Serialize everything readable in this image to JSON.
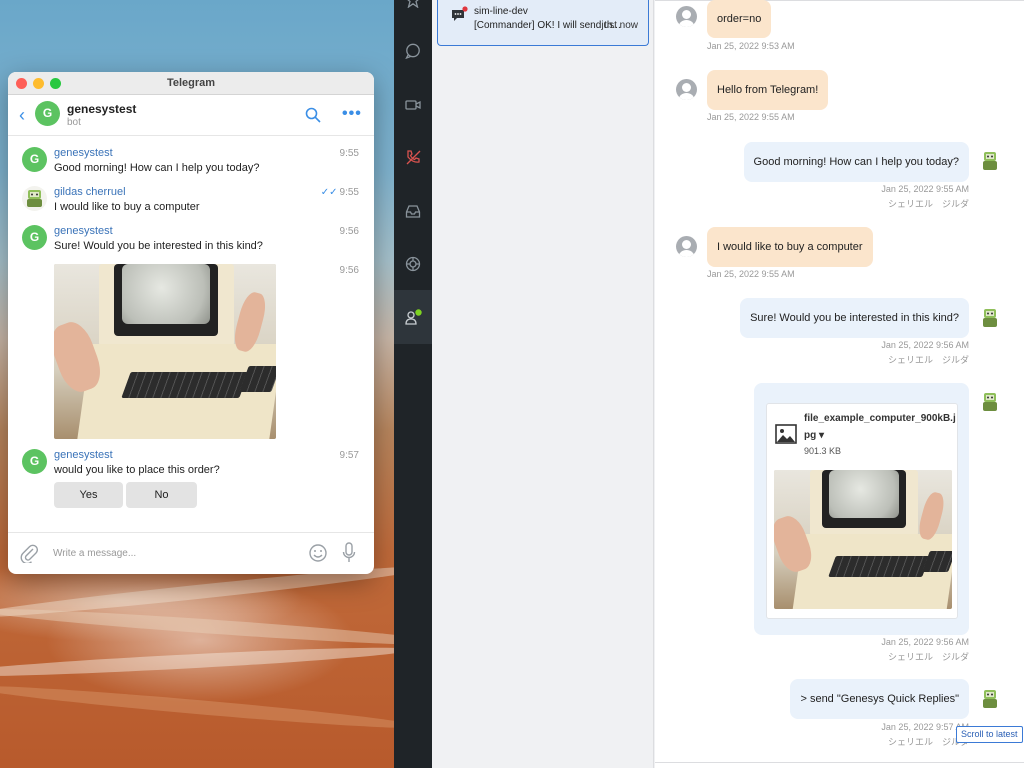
{
  "telegram": {
    "window_title": "Telegram",
    "chat_name": "genesystest",
    "chat_subtitle": "bot",
    "avatar_letter": "G",
    "messages": [
      {
        "sender": "genesystest",
        "text": "Good morning! How can I help you today?",
        "time": "9:55"
      },
      {
        "sender": "gildas cherruel",
        "text": "I would like to buy a computer",
        "time": "9:55"
      },
      {
        "sender": "genesystest",
        "text": "Sure! Would you be interested in this kind?",
        "time": "9:56"
      },
      {
        "sender": "",
        "text": "",
        "time": "9:56"
      },
      {
        "sender": "genesystest",
        "text": "would you like to place this order?",
        "time": "9:57"
      }
    ],
    "quick_replies": [
      "Yes",
      "No"
    ],
    "input_placeholder": "Write a message..."
  },
  "interaction": {
    "name": "sim-line-dev",
    "preview": "[Commander] OK! I will send th...",
    "time": "just now"
  },
  "transcript": {
    "messages": [
      {
        "dir": "in",
        "text": "order=no",
        "meta": "Jan 25, 2022 9:53 AM"
      },
      {
        "dir": "in",
        "text": "Hello from Telegram!",
        "meta": "Jan 25, 2022 9:55 AM"
      },
      {
        "dir": "out",
        "text": "Good morning! How can I help you today?",
        "meta": "Jan 25, 2022 9:55 AM",
        "agent": "シェリエル　ジルダ"
      },
      {
        "dir": "in",
        "text": "I would like to buy a computer",
        "meta": "Jan 25, 2022 9:55 AM"
      },
      {
        "dir": "out",
        "text": "Sure! Would you be interested in this kind?",
        "meta": "Jan 25, 2022 9:56 AM",
        "agent": "シェリエル　ジルダ"
      },
      {
        "dir": "out",
        "text": "",
        "meta": "Jan 25, 2022 9:56 AM",
        "agent": "シェリエル　ジルダ"
      },
      {
        "dir": "out",
        "text": "> send \"Genesys Quick Replies\"",
        "meta": "Jan 25, 2022 9:57 AM",
        "agent": "シェリエル　ジルダ"
      }
    ],
    "file": {
      "name": "file_example_computer_900kB.jpg",
      "caret": "▾",
      "size": "901.3 KB"
    },
    "scroll_label": "Scroll to latest"
  },
  "colors": {
    "accent": "#3b7ad6",
    "customer_bubble": "#fbe5cc",
    "agent_bubble": "#eaf2fb",
    "telegram_green": "#5cc361",
    "rail": "#1f2428"
  }
}
